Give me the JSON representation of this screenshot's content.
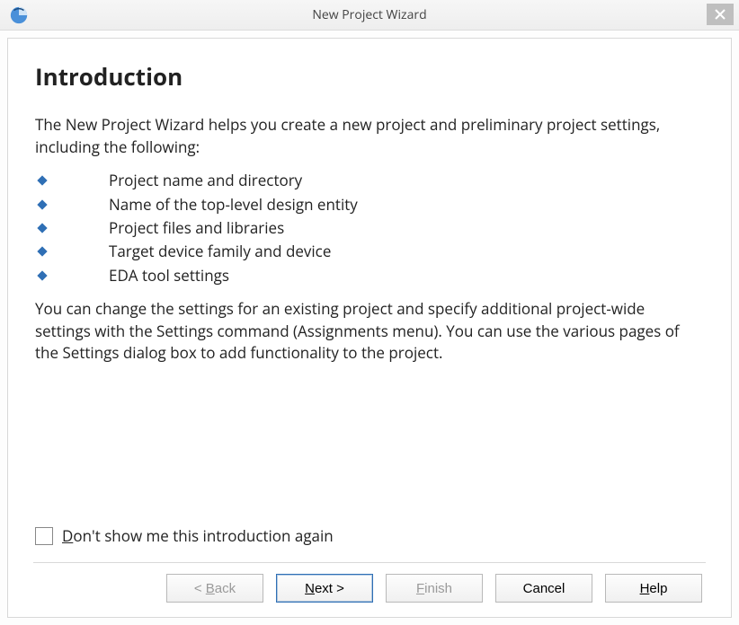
{
  "window": {
    "title": "New Project Wizard"
  },
  "page": {
    "heading": "Introduction",
    "intro_para": "The New Project Wizard helps you create a new project and preliminary project settings, including the following:",
    "bullets": [
      "Project name and directory",
      "Name of the top-level design entity",
      "Project files and libraries",
      "Target device family and device",
      "EDA tool settings"
    ],
    "footer_para": "You can change the settings for an existing project and specify additional project-wide settings with the Settings command (Assignments menu). You can use the various pages of the Settings dialog box to add functionality to the project.",
    "checkbox_label_pre": "D",
    "checkbox_label_post": "on't show me this introduction again"
  },
  "buttons": {
    "back_pre": "< ",
    "back_mn": "B",
    "back_post": "ack",
    "next_mn": "N",
    "next_post": "ext >",
    "finish_mn": "F",
    "finish_post": "inish",
    "cancel": "Cancel",
    "help_mn": "H",
    "help_post": "elp"
  }
}
